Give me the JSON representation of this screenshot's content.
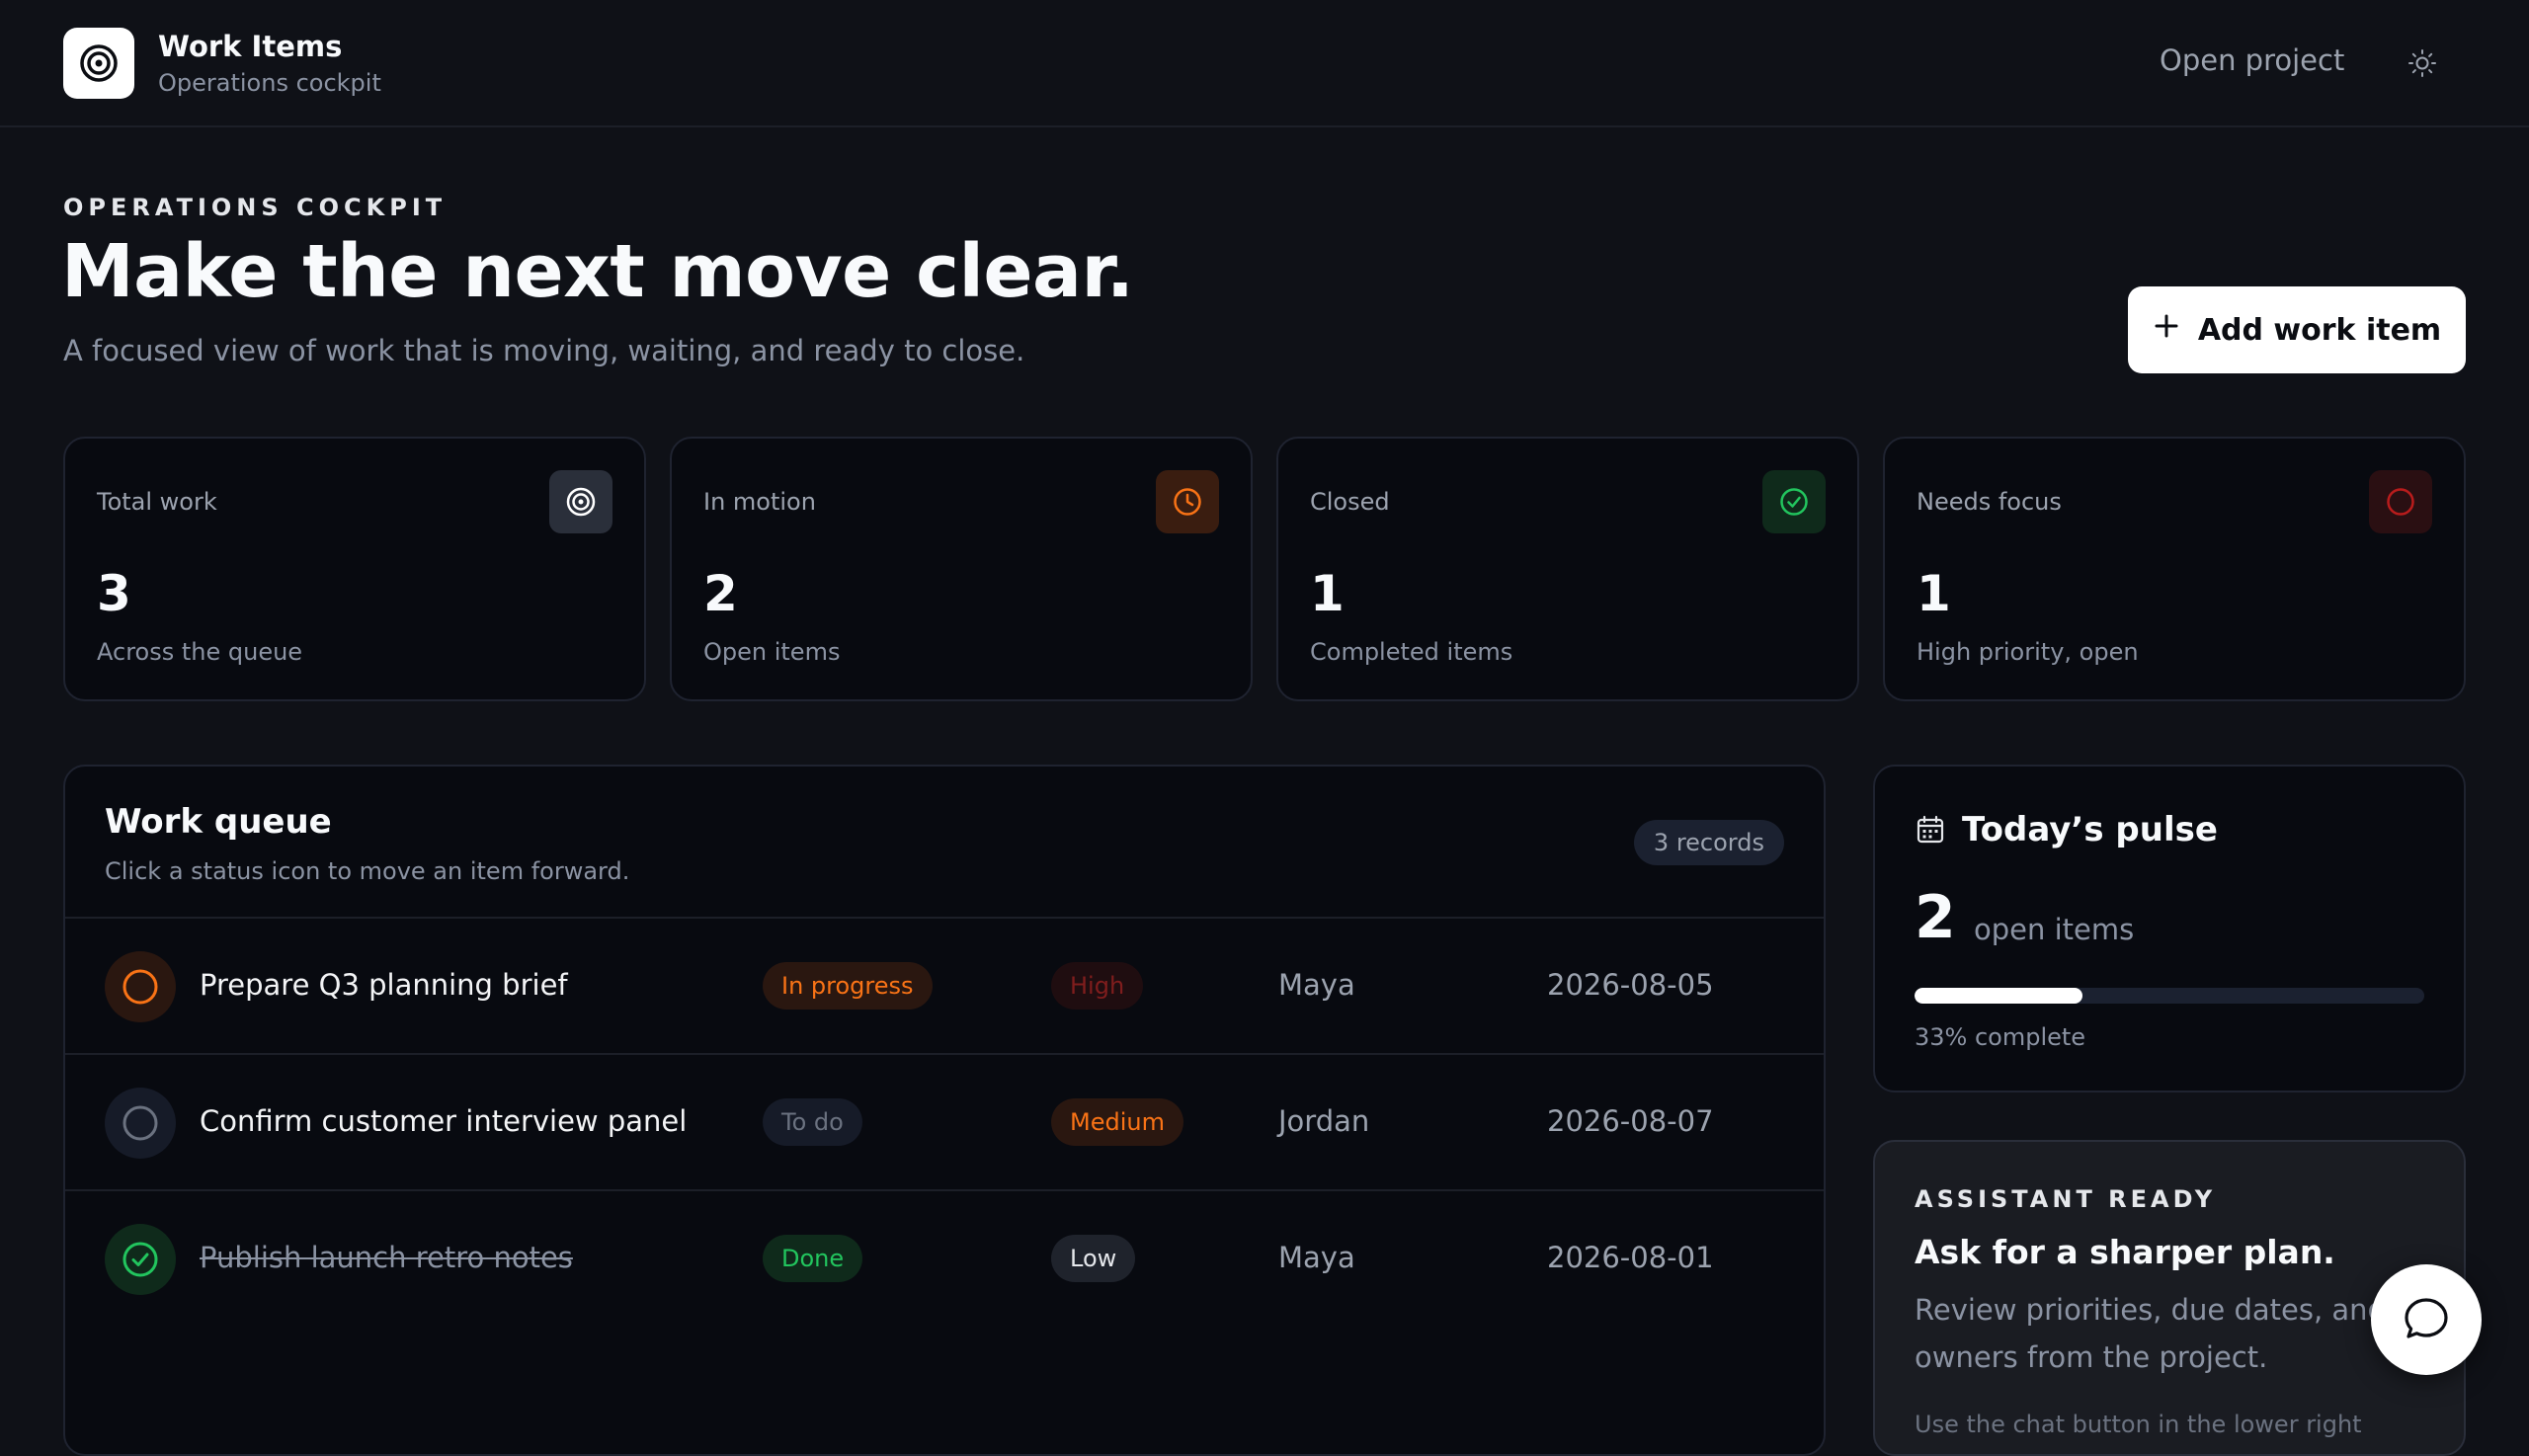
{
  "header": {
    "app_title": "Work Items",
    "app_subtitle": "Operations cockpit",
    "open_project_label": "Open project",
    "logo_icon": "target-icon",
    "theme_icon": "sun-icon"
  },
  "hero": {
    "eyebrow": "OPERATIONS COCKPIT",
    "title": "Make the next move clear.",
    "subtitle": "A focused view of work that is moving, waiting, and ready to close.",
    "add_button_label": "Add work item",
    "add_button_icon": "plus-icon"
  },
  "stats": [
    {
      "label": "Total work",
      "value": "3",
      "note": "Across the queue",
      "icon": "target-icon",
      "color": "#ffffff"
    },
    {
      "label": "In motion",
      "value": "2",
      "note": "Open items",
      "icon": "clock-icon",
      "color": "#f97316"
    },
    {
      "label": "Closed",
      "value": "1",
      "note": "Completed items",
      "icon": "check-circle-icon",
      "color": "#22c55e"
    },
    {
      "label": "Needs focus",
      "value": "1",
      "note": "High priority, open",
      "icon": "circle-icon",
      "color": "#dc2626"
    }
  ],
  "queue": {
    "title": "Work queue",
    "subtitle": "Click a status icon to move an item forward.",
    "records_badge": "3 records",
    "rows": [
      {
        "title": "Prepare Q3 planning brief",
        "status": "In progress",
        "priority": "High",
        "owner": "Maya",
        "due": "2026-08-05"
      },
      {
        "title": "Confirm customer interview panel",
        "status": "To do",
        "priority": "Medium",
        "owner": "Jordan",
        "due": "2026-08-07"
      },
      {
        "title": "Publish launch retro notes",
        "status": "Done",
        "priority": "Low",
        "owner": "Maya",
        "due": "2026-08-01"
      }
    ]
  },
  "pulse": {
    "title": "Today’s pulse",
    "open_count": "2",
    "open_label": "open items",
    "progress_fraction": 0.33,
    "progress_label": "33% complete"
  },
  "assistant": {
    "eyebrow": "ASSISTANT READY",
    "title": "Ask for a sharper plan.",
    "body": "Review priorities, due dates, and owners from the project.",
    "hint": "Use the chat button in the lower right"
  },
  "colors": {
    "background": "#0f1117",
    "card": "#080a10",
    "accent_orange": "#f97316",
    "accent_green": "#22c55e",
    "accent_red": "#dc2626"
  }
}
